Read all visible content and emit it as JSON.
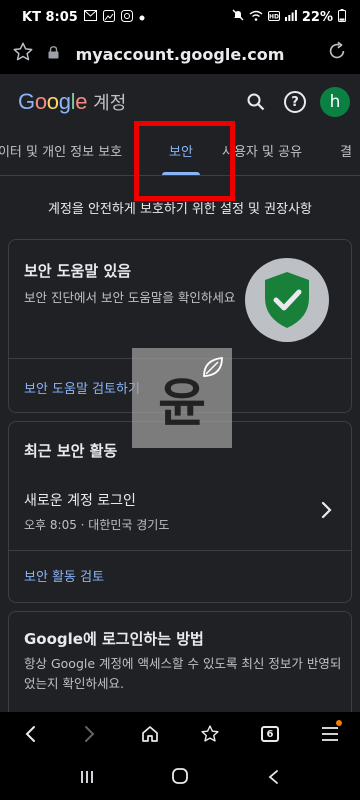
{
  "status_bar": {
    "carrier_time": "KT 8:05",
    "notification_icons": [
      "gmail-icon",
      "image-icon",
      "instagram-icon",
      "dot-icon"
    ],
    "battery": "22%",
    "right_icons": [
      "mute-icon",
      "wifi-icon",
      "hd-icon",
      "signal-icon"
    ]
  },
  "browser": {
    "url": "myaccount.google.com",
    "tab_count": "6"
  },
  "header": {
    "logo": [
      "G",
      "o",
      "o",
      "g",
      "l",
      "e"
    ],
    "subtitle": "계정",
    "avatar_letter": "h"
  },
  "tabs": [
    {
      "label": "데이터 및 개인 정보 보호"
    },
    {
      "label": "보안",
      "active": true
    },
    {
      "label": "사용자 및 공유"
    },
    {
      "label": "결"
    }
  ],
  "intro": "계정을 안전하게 보호하기 위한 설정 및 권장사항",
  "cards": {
    "security_tips": {
      "title": "보안 도움말 있음",
      "description": "보안 진단에서 보안 도움말을 확인하세요",
      "link": "보안 도움말 검토하기"
    },
    "recent_activity": {
      "title": "최근 보안 활동",
      "item_title": "새로운 계정 로그인",
      "item_meta": "오후 8:05 · 대한민국 경기도",
      "link": "보안 활동 검토"
    },
    "sign_in": {
      "title": "Google에 로그인하는 방법",
      "description": "항상 Google 계정에 액세스할 수 있도록 최신 정보가 반영되었는지 확인하세요."
    }
  },
  "watermark": {
    "glyph": "윤"
  },
  "colors": {
    "accent": "#8ab4f8",
    "shield": "#188038",
    "highlight": "#ee0000",
    "background": "#202124"
  }
}
